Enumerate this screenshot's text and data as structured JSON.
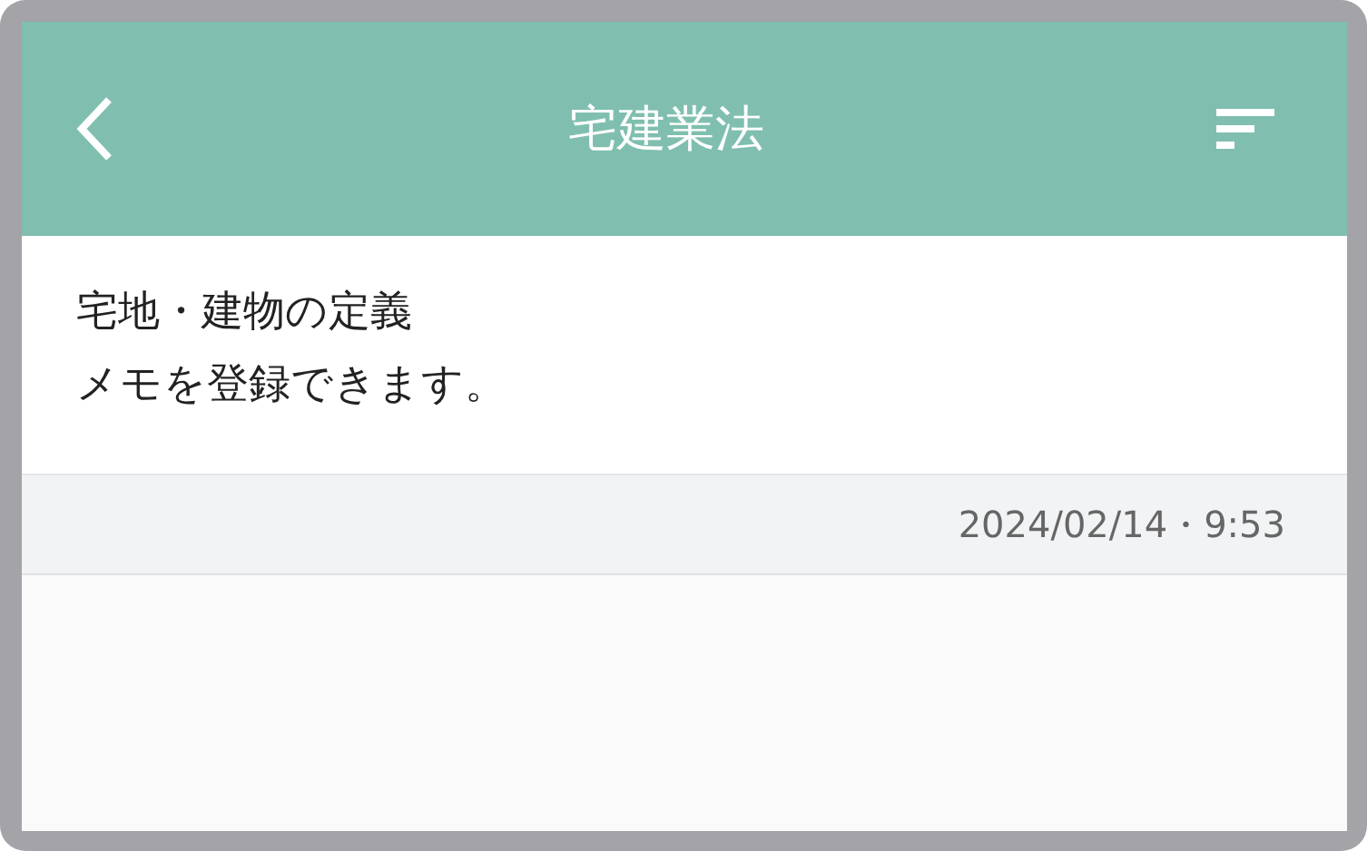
{
  "header": {
    "title": "宅建業法"
  },
  "memo": {
    "title": "宅地・建物の定義",
    "body": "メモを登録できます。",
    "timestamp": "2024/02/14・9:53"
  }
}
